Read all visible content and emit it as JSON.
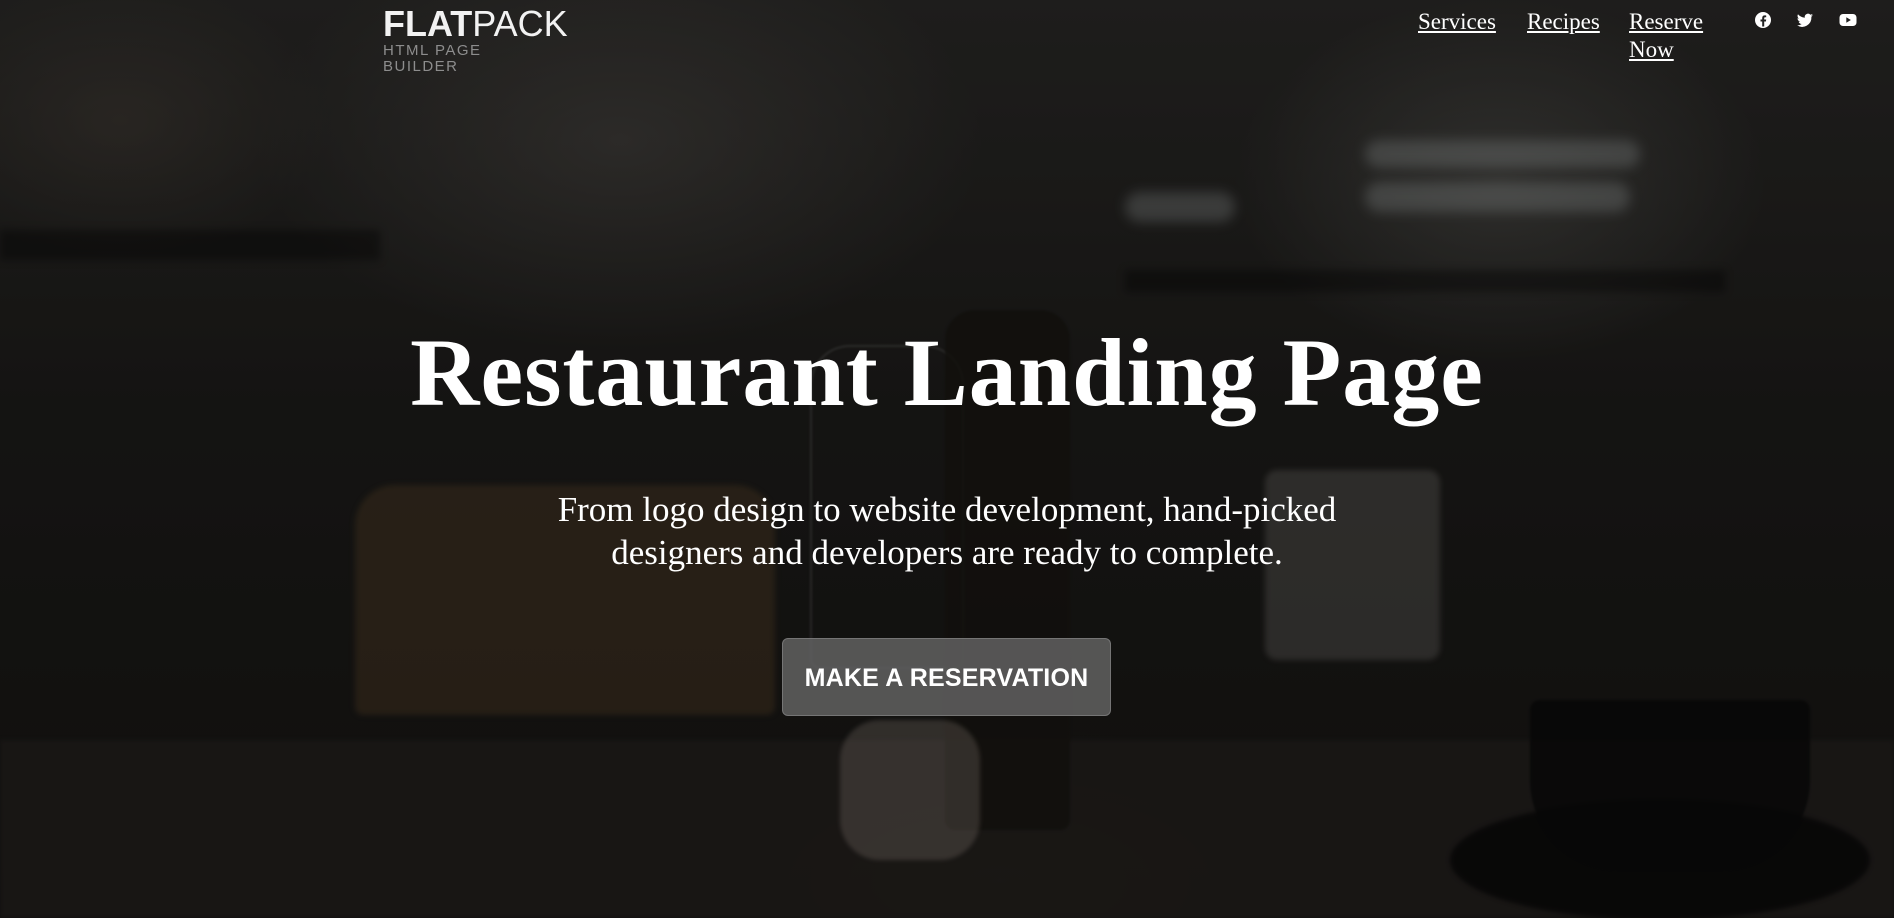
{
  "brand": {
    "name_bold": "FLAT",
    "name_light": "PACK",
    "tagline": "HTML PAGE BUILDER"
  },
  "nav": {
    "items": [
      {
        "label": "Services"
      },
      {
        "label": "Recipes"
      },
      {
        "label": "Reserve Now"
      }
    ]
  },
  "social": {
    "icons": [
      "facebook-icon",
      "twitter-icon",
      "youtube-icon"
    ]
  },
  "hero": {
    "title": "Restaurant Landing Page",
    "subtitle_line1": "From logo design to website development, hand-picked",
    "subtitle_line2": "designers and developers are ready to complete.",
    "cta_label": "MAKE A RESERVATION"
  },
  "colors": {
    "text": "#ffffff",
    "button_bg": "#646464",
    "tagline": "#8d8d8d"
  }
}
